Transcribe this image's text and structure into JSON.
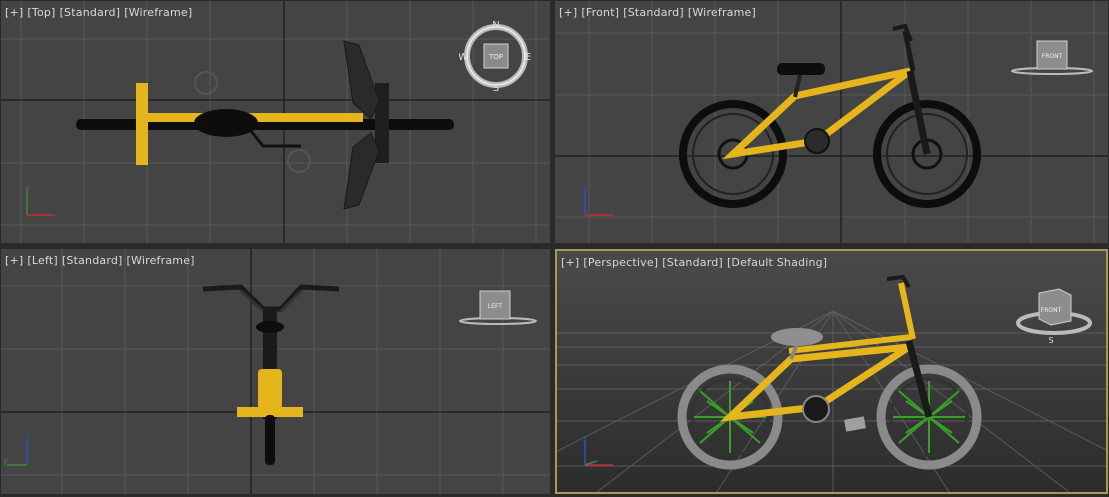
{
  "viewports": {
    "top": {
      "labels": [
        "[+]",
        "[Top]",
        "[Standard]",
        "[Wireframe]"
      ],
      "compass": {
        "n": "N",
        "s": "S",
        "e": "E",
        "w": "W",
        "cube": "TOP"
      }
    },
    "front": {
      "labels": [
        "[+]",
        "[Front]",
        "[Standard]",
        "[Wireframe]"
      ],
      "cube": "FRONT"
    },
    "left": {
      "labels": [
        "[+]",
        "[Left]",
        "[Standard]",
        "[Wireframe]"
      ],
      "cube": "LEFT"
    },
    "perspective": {
      "labels": [
        "[+]",
        "[Perspective]",
        "[Standard]",
        "[Default Shading]"
      ],
      "cube": "FRONT",
      "compass_s": "S",
      "active": true
    }
  },
  "axis_tripod": {
    "x": "x",
    "y": "y",
    "z": "z"
  },
  "colors": {
    "viewport_bg": "#444444",
    "grid": "#575757",
    "grid_axis": "#111111",
    "frame_yellow": "#e5b51c",
    "wheel_dark": "#0d0d0d",
    "spoke_green": "#3aa02a",
    "active_border": "#a89a56"
  },
  "icons": {
    "viewcube": "viewcube-icon",
    "compass": "compass-ring-icon",
    "axis": "axis-tripod-icon"
  }
}
